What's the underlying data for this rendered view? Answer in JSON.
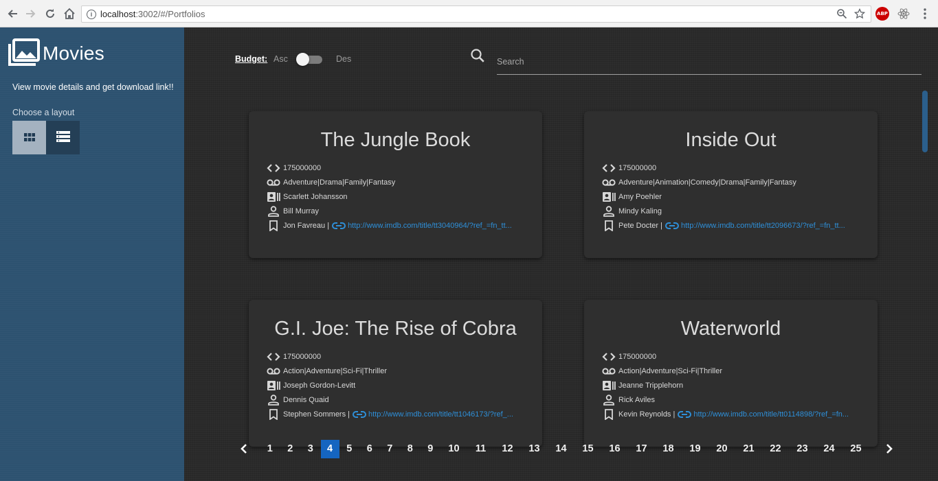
{
  "browser": {
    "url_host": "localhost",
    "url_path": ":3002/#/Portfolios",
    "ext_abp": "ABP"
  },
  "sidebar": {
    "brand": "Movies",
    "tagline": "View movie details and get download link!!",
    "layout_label": "Choose a layout"
  },
  "toolbar": {
    "budget_label": "Budget:",
    "asc_label": "Asc",
    "des_label": "Des",
    "search_placeholder": "Search"
  },
  "movies": [
    {
      "title": "The Jungle Book",
      "budget": "175000000",
      "genres": "Adventure|Drama|Family|Fantasy",
      "actor1": "Scarlett Johansson",
      "actor2": "Bill Murray",
      "director": "Jon Favreau |",
      "link": "http://www.imdb.com/title/tt3040964/?ref_=fn_tt..."
    },
    {
      "title": "Inside Out",
      "budget": "175000000",
      "genres": "Adventure|Animation|Comedy|Drama|Family|Fantasy",
      "actor1": "Amy Poehler",
      "actor2": "Mindy Kaling",
      "director": "Pete Docter |",
      "link": "http://www.imdb.com/title/tt2096673/?ref_=fn_tt..."
    },
    {
      "title": "G.I. Joe: The Rise of Cobra",
      "budget": "175000000",
      "genres": "Action|Adventure|Sci-Fi|Thriller",
      "actor1": "Joseph Gordon-Levitt",
      "actor2": "Dennis Quaid",
      "director": "Stephen Sommers |",
      "link": "http://www.imdb.com/title/tt1046173/?ref_..."
    },
    {
      "title": "Waterworld",
      "budget": "175000000",
      "genres": "Action|Adventure|Sci-Fi|Thriller",
      "actor1": "Jeanne Tripplehorn",
      "actor2": "Rick Aviles",
      "director": "Kevin Reynolds |",
      "link": "http://www.imdb.com/title/tt0114898/?ref_=fn..."
    }
  ],
  "pagination": {
    "pages": [
      "1",
      "2",
      "3",
      "4",
      "5",
      "6",
      "7",
      "8",
      "9",
      "10",
      "11",
      "12",
      "13",
      "14",
      "15",
      "16",
      "17",
      "18",
      "19",
      "20",
      "21",
      "22",
      "23",
      "24",
      "25"
    ],
    "current": "4"
  },
  "colors": {
    "sidebar_bg": "#2d5270",
    "active_page": "#1565c0",
    "link": "#2e8fd8"
  }
}
